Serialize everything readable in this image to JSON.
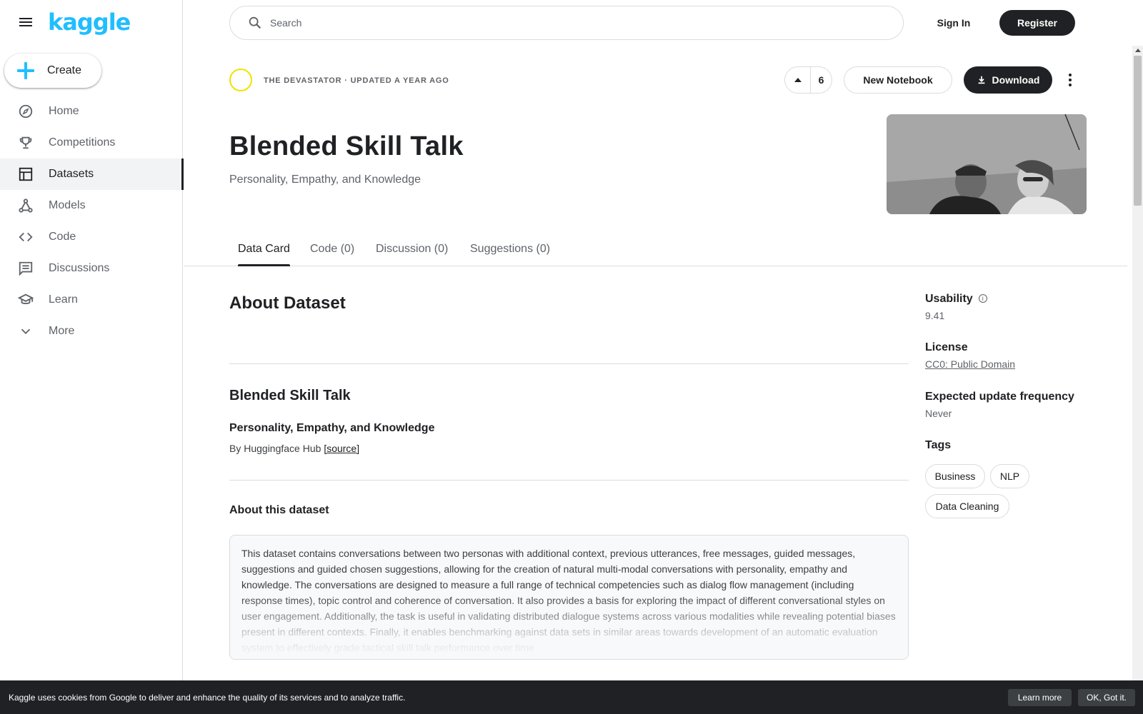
{
  "app": {
    "logo_text": "kaggle",
    "brand_color": "#20beff"
  },
  "sidebar": {
    "create_label": "Create",
    "items": [
      {
        "label": "Home",
        "icon": "compass-icon"
      },
      {
        "label": "Competitions",
        "icon": "trophy-icon"
      },
      {
        "label": "Datasets",
        "icon": "table-icon",
        "active": true
      },
      {
        "label": "Models",
        "icon": "models-icon"
      },
      {
        "label": "Code",
        "icon": "code-icon"
      },
      {
        "label": "Discussions",
        "icon": "comment-icon"
      },
      {
        "label": "Learn",
        "icon": "school-icon"
      },
      {
        "label": "More",
        "icon": "chevron-down-icon"
      }
    ]
  },
  "topbar": {
    "search_placeholder": "Search",
    "signin_label": "Sign In",
    "register_label": "Register"
  },
  "dataset": {
    "owner_line": "THE DEVASTATOR · UPDATED A YEAR AGO",
    "upvotes": "6",
    "new_notebook_label": "New Notebook",
    "download_label": "Download",
    "title": "Blended Skill Talk",
    "subtitle": "Personality, Empathy, and Knowledge"
  },
  "tabs": [
    "Data Card",
    "Code (0)",
    "Discussion (0)",
    "Suggestions (0)"
  ],
  "content": {
    "about_heading": "About Dataset",
    "section_title": "Blended Skill Talk",
    "section_subtitle": "Personality, Empathy, and Knowledge",
    "by_prefix": "By Huggingface Hub",
    "source_link": "[source]",
    "about_this_heading": "About this dataset",
    "description": "This dataset contains conversations between two personas with additional context, previous utterances, free messages, guided messages, suggestions and guided chosen suggestions, allowing for the creation of natural multi-modal conversations with personality, empathy and knowledge. The conversations are designed to measure a full range of technical competencies such as dialog flow management (including response times), topic control and coherence of conversation. It also provides a basis for exploring the impact of different conversational styles on user engagement. Additionally, the task is useful in validating distributed dialogue systems across various modalities while revealing potential biases present in different contexts. Finally, it enables benchmarking against data sets in similar areas towards development of an automatic evaluation system to effectively grade tactical skill talk performance over time"
  },
  "meta": {
    "usability_label": "Usability",
    "usability_value": "9.41",
    "license_label": "License",
    "license_value": "CC0: Public Domain",
    "frequency_label": "Expected update frequency",
    "frequency_value": "Never",
    "tags_label": "Tags",
    "tags": [
      "Business",
      "NLP",
      "Data Cleaning"
    ]
  },
  "cookie": {
    "message": "Kaggle uses cookies from Google to deliver and enhance the quality of its services and to analyze traffic.",
    "learn_more": "Learn more",
    "ok": "OK, Got it."
  }
}
